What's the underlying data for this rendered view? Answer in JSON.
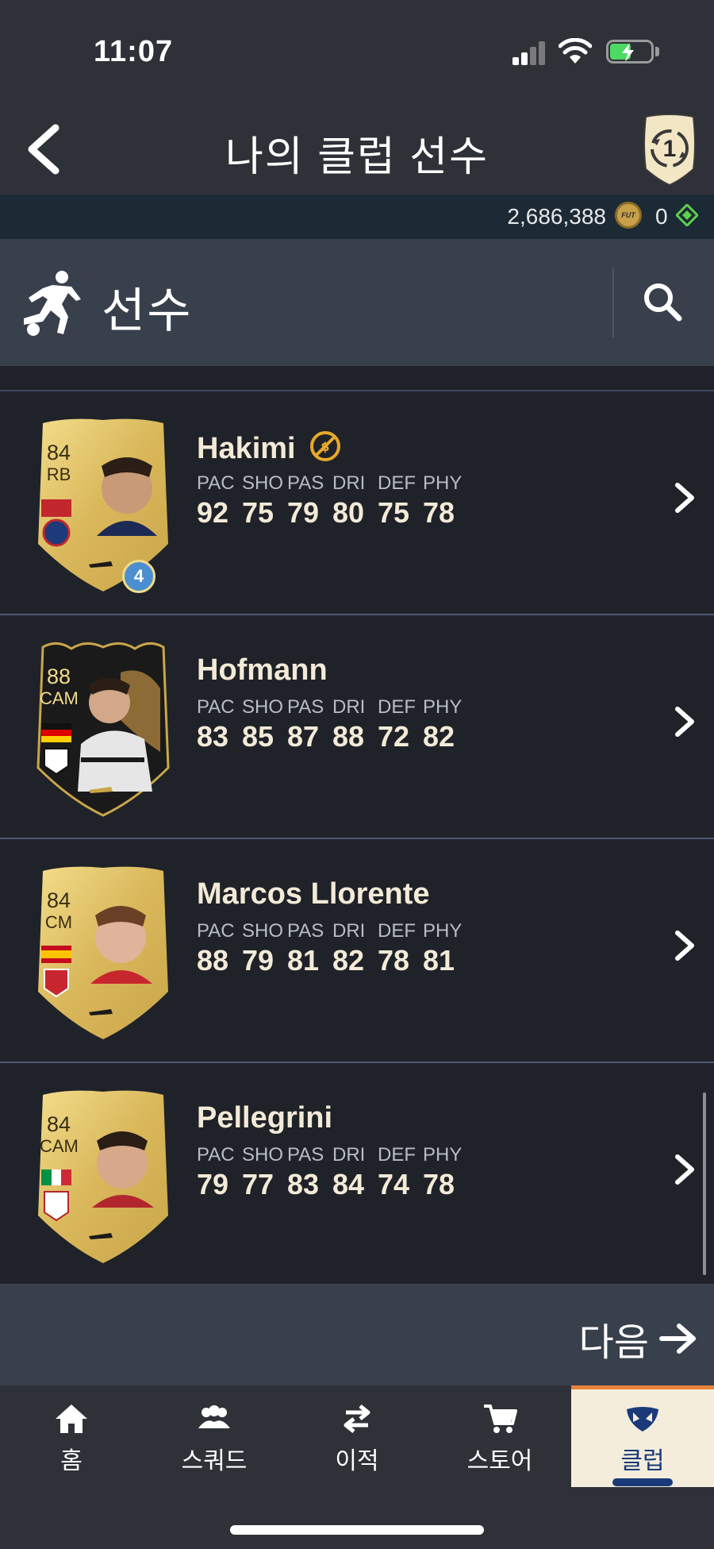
{
  "status_bar": {
    "time": "11:07"
  },
  "header": {
    "title": "나의 클럽 선수",
    "badge_number": "1"
  },
  "currency": {
    "coins": "2,686,388",
    "coin_icon_text": "FUT",
    "points": "0"
  },
  "section": {
    "title": "선수"
  },
  "stat_labels": [
    "PAC",
    "SHO",
    "PAS",
    "DRI",
    "DEF",
    "PHY"
  ],
  "players": [
    {
      "name": "Hakimi",
      "rating": "84",
      "position": "RB",
      "stats": [
        "92",
        "75",
        "79",
        "80",
        "75",
        "78"
      ],
      "chemistry_badge": "4",
      "untradeable": true,
      "card_style": "gold"
    },
    {
      "name": "Hofmann",
      "rating": "88",
      "position": "CAM",
      "stats": [
        "83",
        "85",
        "87",
        "88",
        "72",
        "82"
      ],
      "card_style": "inform"
    },
    {
      "name": "Marcos Llorente",
      "rating": "84",
      "position": "CM",
      "stats": [
        "88",
        "79",
        "81",
        "82",
        "78",
        "81"
      ],
      "card_style": "gold"
    },
    {
      "name": "Pellegrini",
      "rating": "84",
      "position": "CAM",
      "stats": [
        "79",
        "77",
        "83",
        "84",
        "74",
        "78"
      ],
      "card_style": "gold"
    }
  ],
  "next_button": {
    "label": "다음"
  },
  "tabs": [
    {
      "label": "홈",
      "icon": "home-icon"
    },
    {
      "label": "스쿼드",
      "icon": "squad-icon"
    },
    {
      "label": "이적",
      "icon": "transfer-icon"
    },
    {
      "label": "스토어",
      "icon": "store-icon"
    },
    {
      "label": "클럽",
      "icon": "club-icon",
      "active": true
    }
  ],
  "colors": {
    "background": "#1f2228",
    "header": "#2f3138",
    "section": "#38404c",
    "name_text": "#f3ead7",
    "active_tab_bg": "#f4eddc",
    "active_tab_accent": "#e8813a",
    "active_tab_text": "#1a3a7a"
  }
}
